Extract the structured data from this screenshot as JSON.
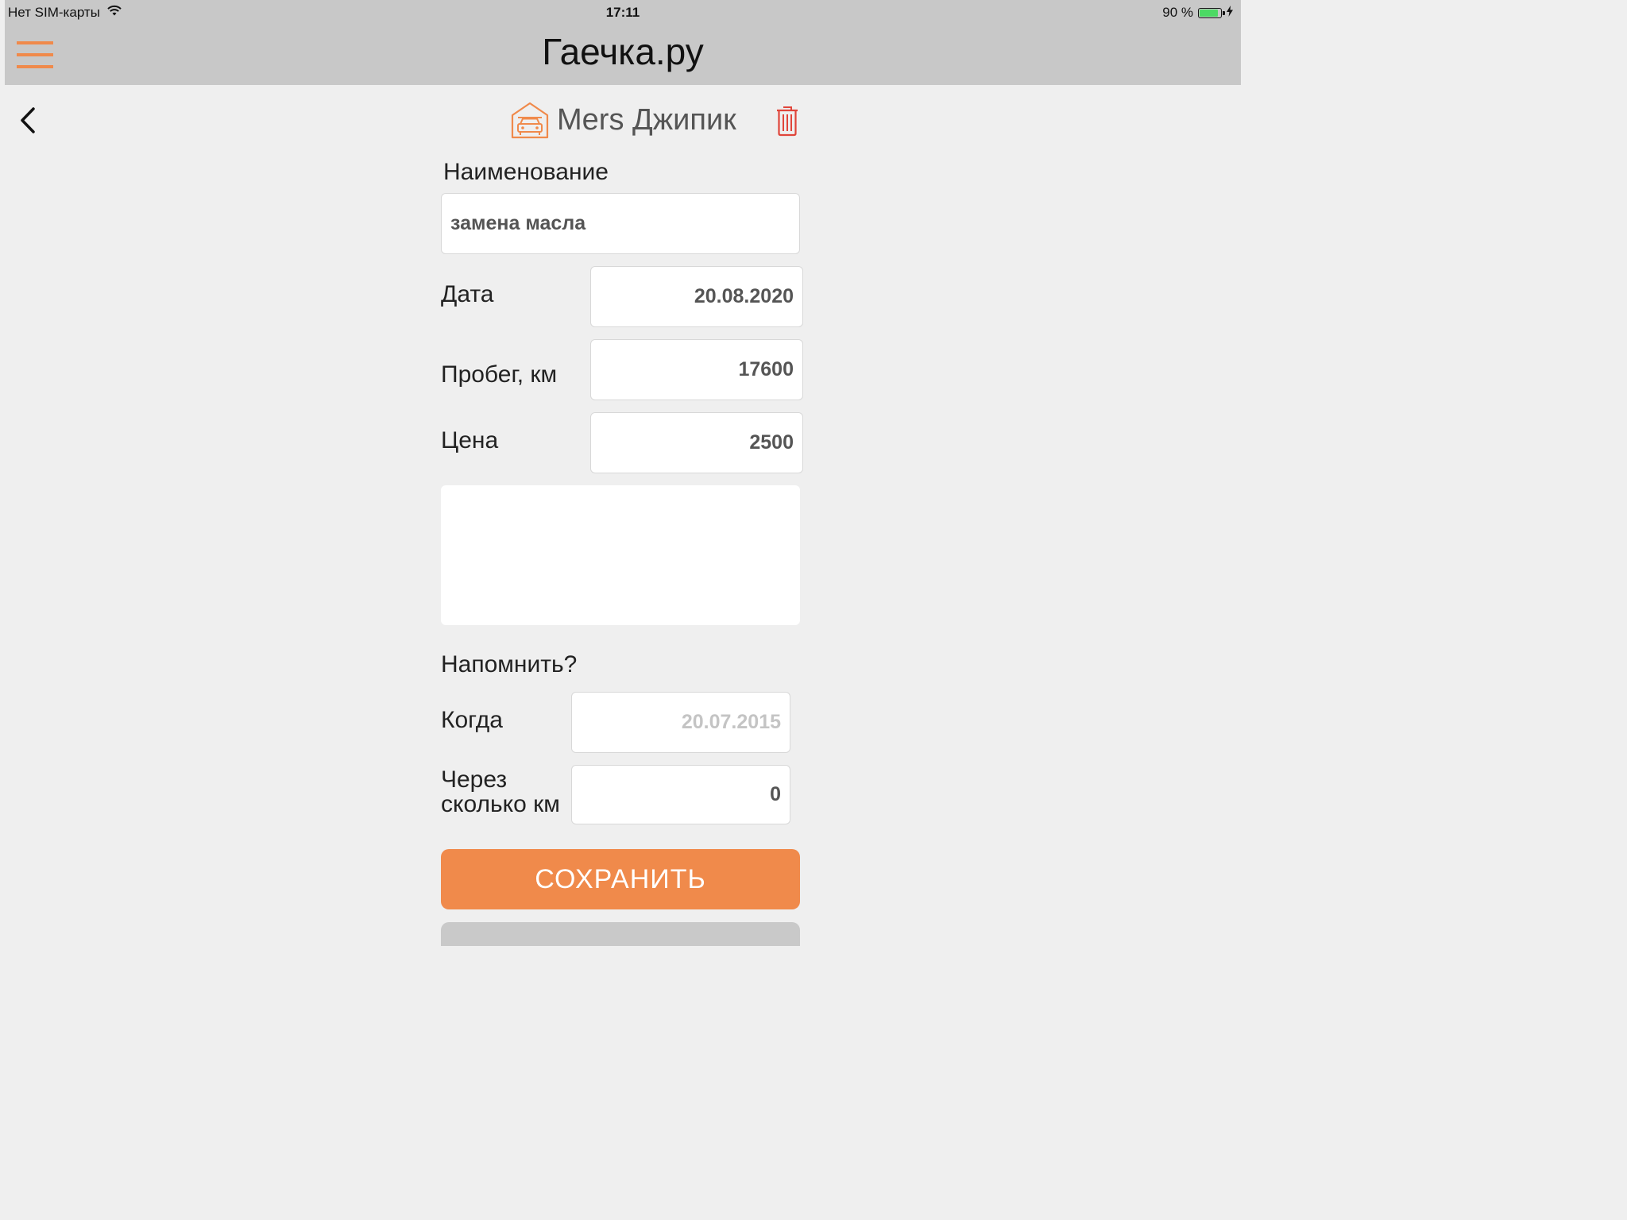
{
  "status_bar": {
    "carrier": "Нет SIM-карты",
    "time": "17:11",
    "battery": "90 %",
    "battery_level": 0.9
  },
  "header": {
    "title": "Гаечка.ру",
    "menu_icon": "hamburger-menu-icon"
  },
  "subheader": {
    "back_icon": "chevron-left-icon",
    "car_icon": "garage-car-icon",
    "car_name": "Mers Джипик",
    "delete_icon": "trash-icon"
  },
  "form": {
    "name_label": "Наименование",
    "name_value": "замена масла",
    "date_label": "Дата",
    "date_value": "20.08.2020",
    "mileage_label": "Пробег, км",
    "mileage_value": "17600",
    "price_label": "Цена",
    "price_value": "2500",
    "notes_value": "",
    "remind_label": "Напомнить?",
    "when_label": "Когда",
    "when_placeholder": "20.07.2015",
    "after_km_label_line1": "Через",
    "after_km_label_line2": "сколько км",
    "after_km_value": "0",
    "save_label": "СОХРАНИТЬ"
  },
  "colors": {
    "accent": "#f08a4b",
    "bar": "#c8c8c8",
    "background": "#efefef",
    "delete": "#e0453a"
  }
}
